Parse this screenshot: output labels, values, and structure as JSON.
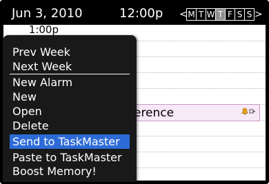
{
  "header": {
    "date": "Jun 3, 2010",
    "time": "12:00p",
    "days": [
      "M",
      "T",
      "W",
      "T",
      "F",
      "S",
      "S"
    ],
    "active_day_index": 3,
    "prev_arrow": "<",
    "next_arrow": ">"
  },
  "calendar": {
    "time_label": "1:00p",
    "event": {
      "title_visible": "ference",
      "icons": [
        "alarm-bell-icon",
        "recurrence-icon"
      ]
    }
  },
  "menu": {
    "items": [
      {
        "label": "Prev Week"
      },
      {
        "label": "Next Week"
      },
      {
        "label": "New Alarm"
      },
      {
        "label": "New"
      },
      {
        "label": "Open"
      },
      {
        "label": "Delete"
      },
      {
        "label": "Send to TaskMaster"
      },
      {
        "label": "Paste to TaskMaster"
      },
      {
        "label": "Boost Memory!"
      }
    ],
    "selected_index": 6
  },
  "colors": {
    "header_bg": "#000000",
    "menu_bg": "#191919",
    "selection": "#2d6bd6",
    "event_bg": "#f7e9f6",
    "active_day": "#8f8f8f",
    "bell": "#e8a317"
  }
}
